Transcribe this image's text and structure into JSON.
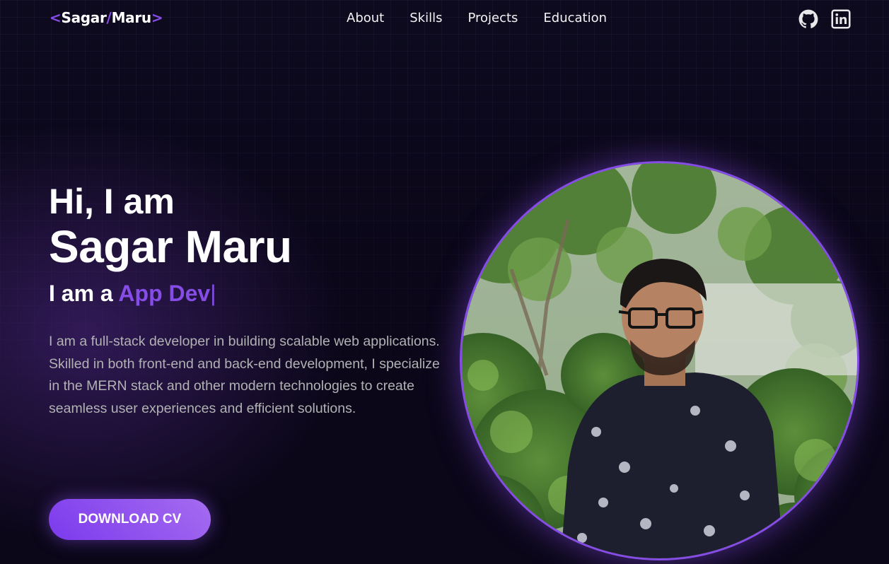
{
  "nav": {
    "logo": {
      "open": "<",
      "first": "Sagar",
      "slash": "/",
      "last": "Maru",
      "close": ">"
    },
    "links": [
      "About",
      "Skills",
      "Projects",
      "Education"
    ],
    "socials": [
      "github-icon",
      "linkedin-icon"
    ]
  },
  "hero": {
    "greeting": "Hi, I am",
    "name": "Sagar Maru",
    "role_prefix": "I am a",
    "role_typed": "App Dev",
    "cursor": "|",
    "description": "I am a full-stack developer in building scalable web applications. Skilled in both front-end and back-end development, I specialize in the MERN stack and other modern technologies to create seamless user experiences and efficient solutions.",
    "cv_button": "DOWNLOAD CV"
  },
  "colors": {
    "accent": "#854ce6",
    "background": "#0b0719",
    "text_primary": "#f2f3f4",
    "text_secondary": "#b1b2b3"
  }
}
